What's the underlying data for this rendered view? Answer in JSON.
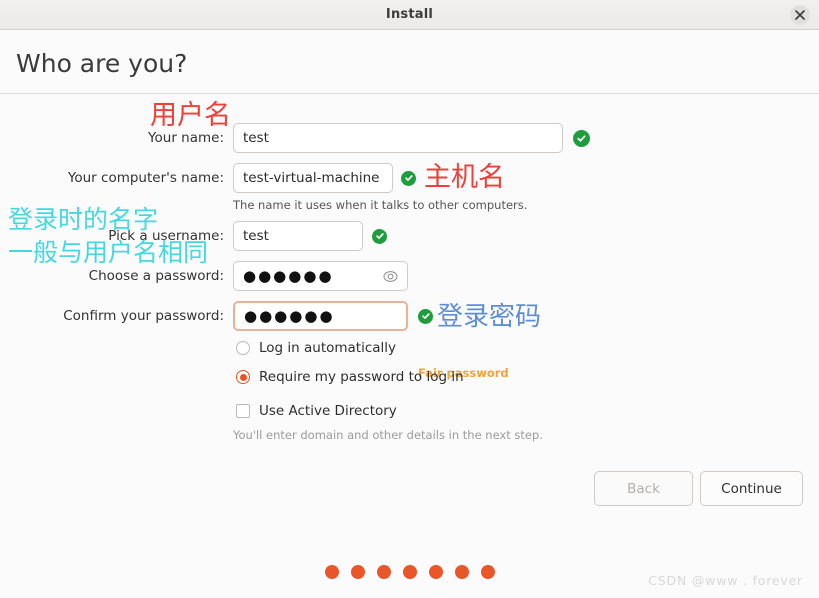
{
  "window": {
    "title": "Install",
    "close_icon": "close-icon"
  },
  "header": {
    "title": "Who are you?"
  },
  "form": {
    "fields": [
      {
        "label": "Your name:",
        "value": "test",
        "valid": true
      },
      {
        "label": "Your computer's name:",
        "value": "test-virtual-machine",
        "valid": true
      },
      {
        "label": "Pick a username:",
        "value": "test",
        "valid": true
      },
      {
        "label": "Choose a password:",
        "value": "●●●●●●",
        "valid": false
      },
      {
        "label": "Confirm your password:",
        "value": "●●●●●●",
        "valid": true
      }
    ],
    "computer_name_hint": "The name it uses when it talks to other computers.",
    "password_strength": "Fair password",
    "password_strength_color": "#f2a13c",
    "reveal_icon": "eye-icon",
    "valid_icon": "check-circle-icon"
  },
  "options": {
    "login_auto": "Log in automatically",
    "require_password": "Require my password to log in",
    "use_active_directory": "Use Active Directory",
    "active_directory_hint": "You'll enter domain and other details in the next step.",
    "selected_login_mode": "require_password",
    "active_directory_checked": false,
    "accent_color": "#e95420"
  },
  "footer": {
    "back_label": "Back",
    "back_disabled": true,
    "continue_label": "Continue",
    "progress_dots": 7,
    "progress_dot_color": "#e8562a",
    "watermark": "CSDN @www . forever"
  },
  "annotations": [
    {
      "text": "用户名",
      "color": "#ec4038"
    },
    {
      "text": "主机名",
      "color": "#ec4038"
    },
    {
      "text": "登录时的名字",
      "color": "#45d8e2"
    },
    {
      "text": "一般与用户名相同",
      "color": "#45d8e2"
    },
    {
      "text": "登录密码",
      "color": "#5d8ed6"
    }
  ]
}
